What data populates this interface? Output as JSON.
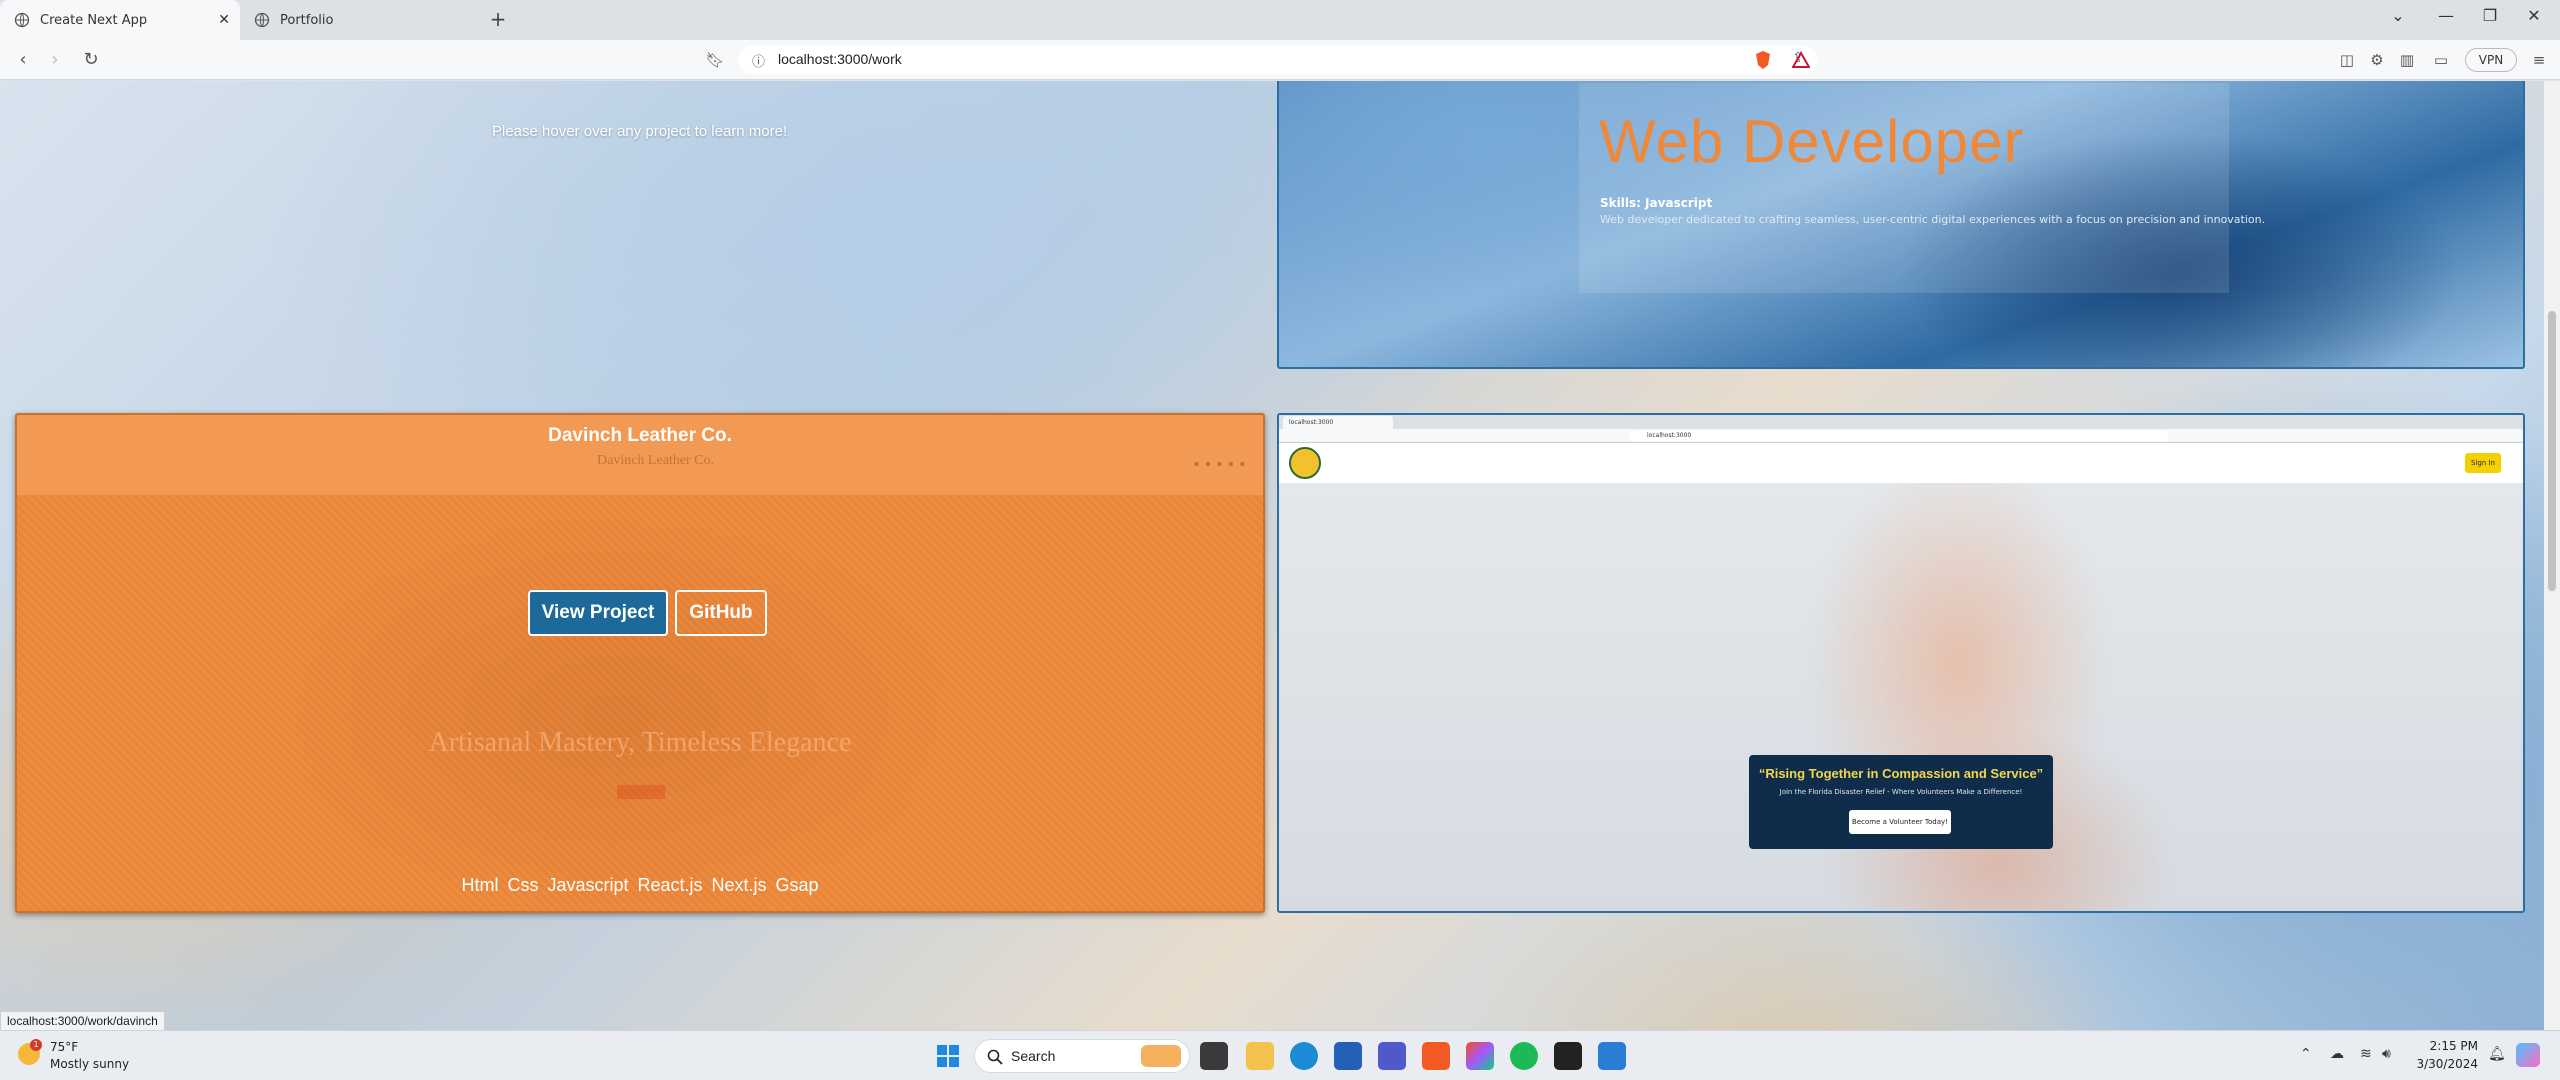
{
  "browser": {
    "tabs": [
      {
        "label": "Create Next App",
        "active": true
      },
      {
        "label": "Portfolio",
        "active": false
      }
    ],
    "url": "localhost:3000/work",
    "vpn_label": "VPN",
    "status_url": "localhost:3000/work/davinch"
  },
  "page": {
    "hover_hint": "Please hover over any project to learn more!",
    "web_card": {
      "title": "Web Developer",
      "skills": "Skills: Javascript",
      "description": "Web developer dedicated to crafting seamless, user-centric digital experiences with a focus on precision and innovation."
    },
    "davinch_card": {
      "title": "Davinch Leather Co.",
      "view_button": "View Project",
      "github_button": "GitHub",
      "tech": "Html Css Javascript React.js Next.js Gsap",
      "preview_brand": "Davinch Leather Co.",
      "preview_hero": "Artisanal Mastery, Timeless Elegance"
    },
    "volunteer_card": {
      "mini_tab": "localhost:3000",
      "mini_url": "localhost:3000",
      "signin": "Sign In",
      "headline": "“Rising Together in Compassion and Service”",
      "subtext": "Join the Florida Disaster Relief - Where Volunteers Make a Difference!",
      "cta": "Become a Volunteer Today!"
    }
  },
  "taskbar": {
    "weather_temp": "75°F",
    "weather_desc": "Mostly sunny",
    "weather_badge": "1",
    "search_label": "Search",
    "time": "2:15 PM",
    "date": "3/30/2024"
  },
  "colors": {
    "accent_orange": "#ef8a3c",
    "button_blue": "#1d6a9a",
    "volunteer_navy": "#0f2d4a",
    "headline_yellow": "#f3d64d"
  }
}
